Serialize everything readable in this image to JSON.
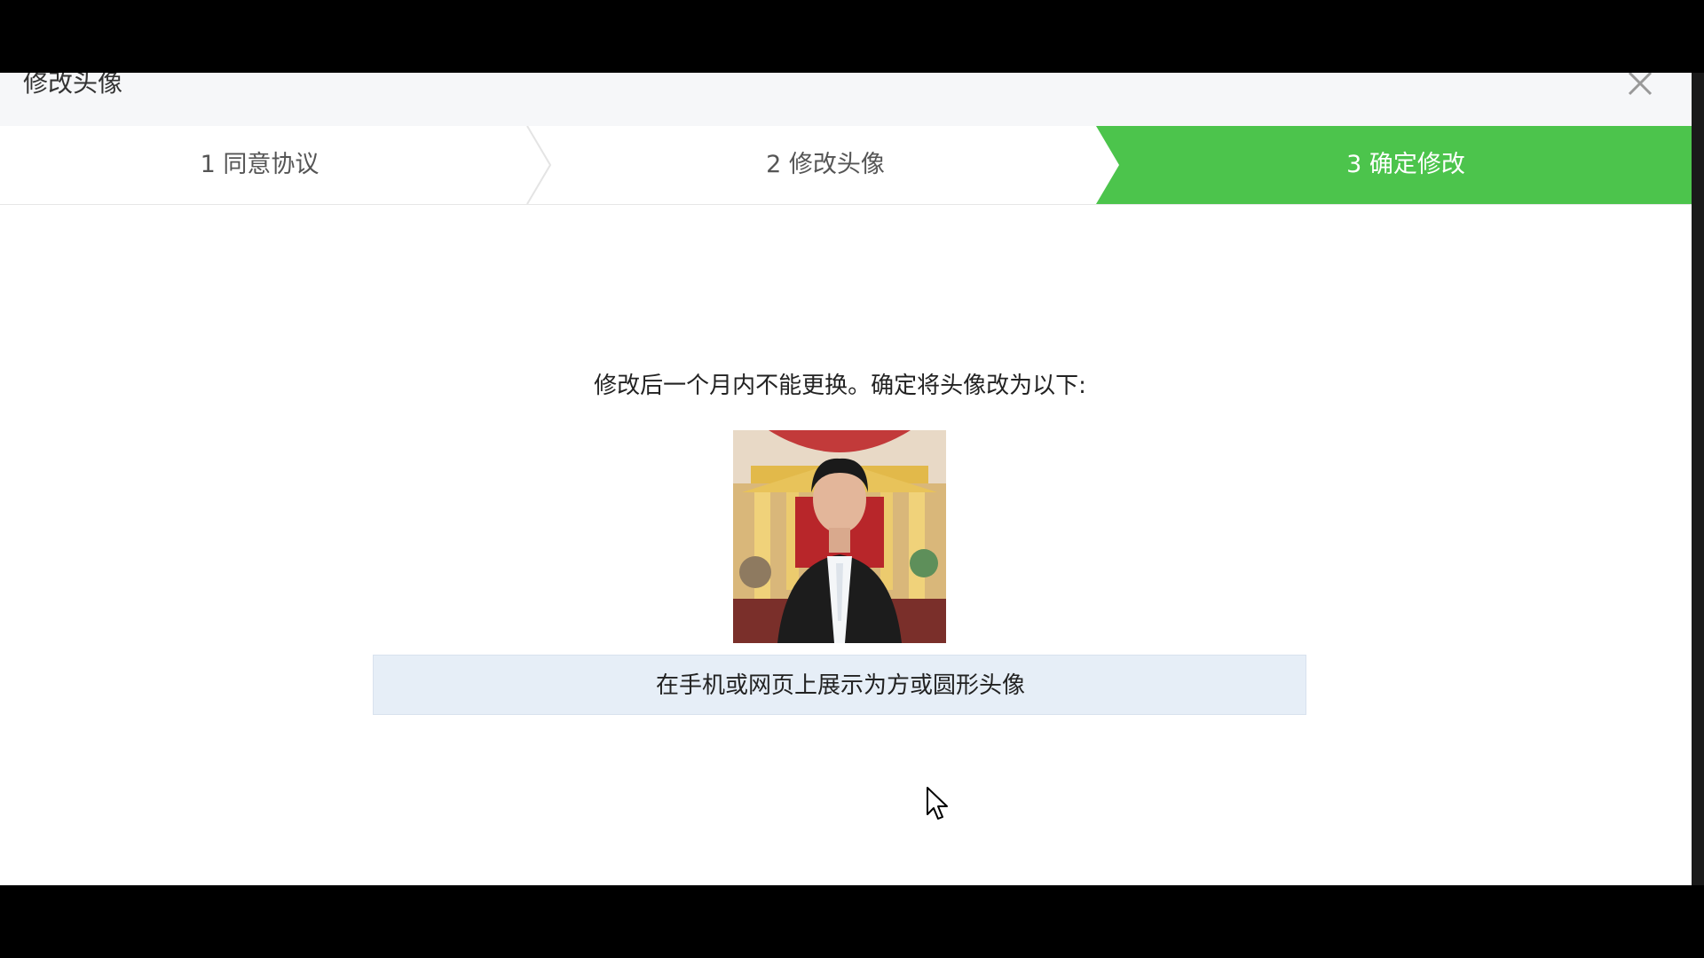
{
  "dialog": {
    "title": "修改头像",
    "close_icon": "close-icon"
  },
  "steps": [
    {
      "label": "1 同意协议",
      "active": false
    },
    {
      "label": "2 修改头像",
      "active": false
    },
    {
      "label": "3 确定修改",
      "active": true
    }
  ],
  "confirm": {
    "notice": "修改后一个月内不能更换。确定将头像改为以下:",
    "display_note": "在手机或网页上展示为方或圆形头像"
  },
  "colors": {
    "active_step": "#4cc44c",
    "display_bar": "#e6eef7"
  }
}
